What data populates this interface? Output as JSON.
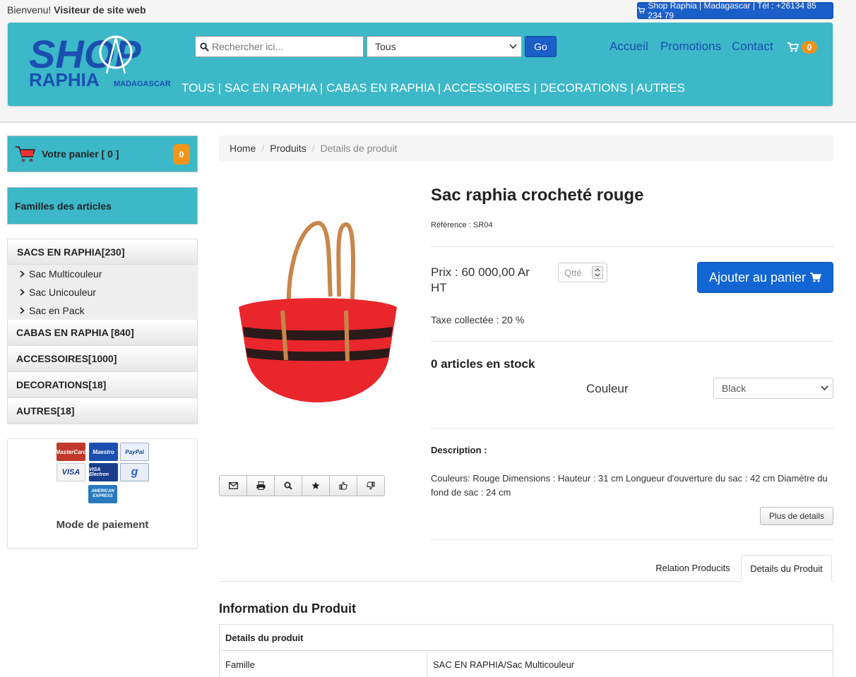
{
  "top": {
    "welcome_prefix": "Bienvenu!",
    "welcome_user": "Visiteur de site web",
    "contact_label": "Shop Raphia | Madagascar | Tél : +26134 85 234 79"
  },
  "header": {
    "logo_shop": "SHOP",
    "logo_raphia": "RAPHIA",
    "logo_madagascar": "MADAGASCAR",
    "search_placeholder": "Rechercher ici...",
    "category_select": "Tous",
    "go_label": "Go",
    "nav": [
      "Accueil",
      "Promotions",
      "Contact"
    ],
    "cart_count": "0",
    "categories_menu": "TOUS | SAC EN RAPHIA | CABAS EN RAPHIA | ACCESSOIRES | DECORATIONS | AUTRES",
    "colors": {
      "header_bg": "#3cb8c8",
      "primary": "#1a5fc8",
      "badge": "#f0941a"
    }
  },
  "sidebar": {
    "cart_label": "Votre panier [ 0 ]",
    "cart_badge": "0",
    "families_title": "Familles des articles",
    "categories": [
      {
        "label": "SACS EN RAPHIA[230]",
        "sub": [
          "Sac Multicouleur",
          "Sac Unicouleur",
          "Sac en Pack"
        ]
      },
      {
        "label": "CABAS EN RAPHIA [840]"
      },
      {
        "label": "ACCESSOIRES[1000]"
      },
      {
        "label": "DECORATIONS[18]"
      },
      {
        "label": "AUTRES[18]"
      }
    ],
    "payment": {
      "cards": [
        "MasterCard",
        "Maestro",
        "PayPal",
        "VISA",
        "VISA Electron",
        "g",
        "AMERICAN EXPRESS"
      ],
      "label": "Mode de paiement"
    }
  },
  "breadcrumb": [
    "Home",
    "Produits",
    "Details de produit"
  ],
  "product": {
    "title": "Sac raphia crocheté rouge",
    "reference": "Référence : SR04",
    "price": "Prix : 60 000,00 Ar HT",
    "qty_placeholder": "Qtté",
    "add_to_cart": "Ajouter au panier",
    "tax": "Taxe collectée : 20 %",
    "stock": "0 articles en stock",
    "color_label": "Couleur",
    "color_value": "Black",
    "description_title": "Description :",
    "description": "Couleurs: Rouge Dimensions : Hauteur : 31 cm Longueur d'ouverture du sac : 42 cm Diamètre du fond de sac : 24 cm",
    "more_details": "Plus de details",
    "tools": [
      "email-icon",
      "print-icon",
      "zoom-icon",
      "star-icon",
      "thumbs-up-icon",
      "thumbs-down-icon"
    ]
  },
  "tabs": [
    "Relation Producits",
    "Details du Produit"
  ],
  "info": {
    "title": "Information du Produit",
    "table_header": "Details du produit",
    "rows": [
      {
        "key": "Famille",
        "value": "SAC EN RAPHIA/Sac Multicouleur"
      }
    ]
  }
}
